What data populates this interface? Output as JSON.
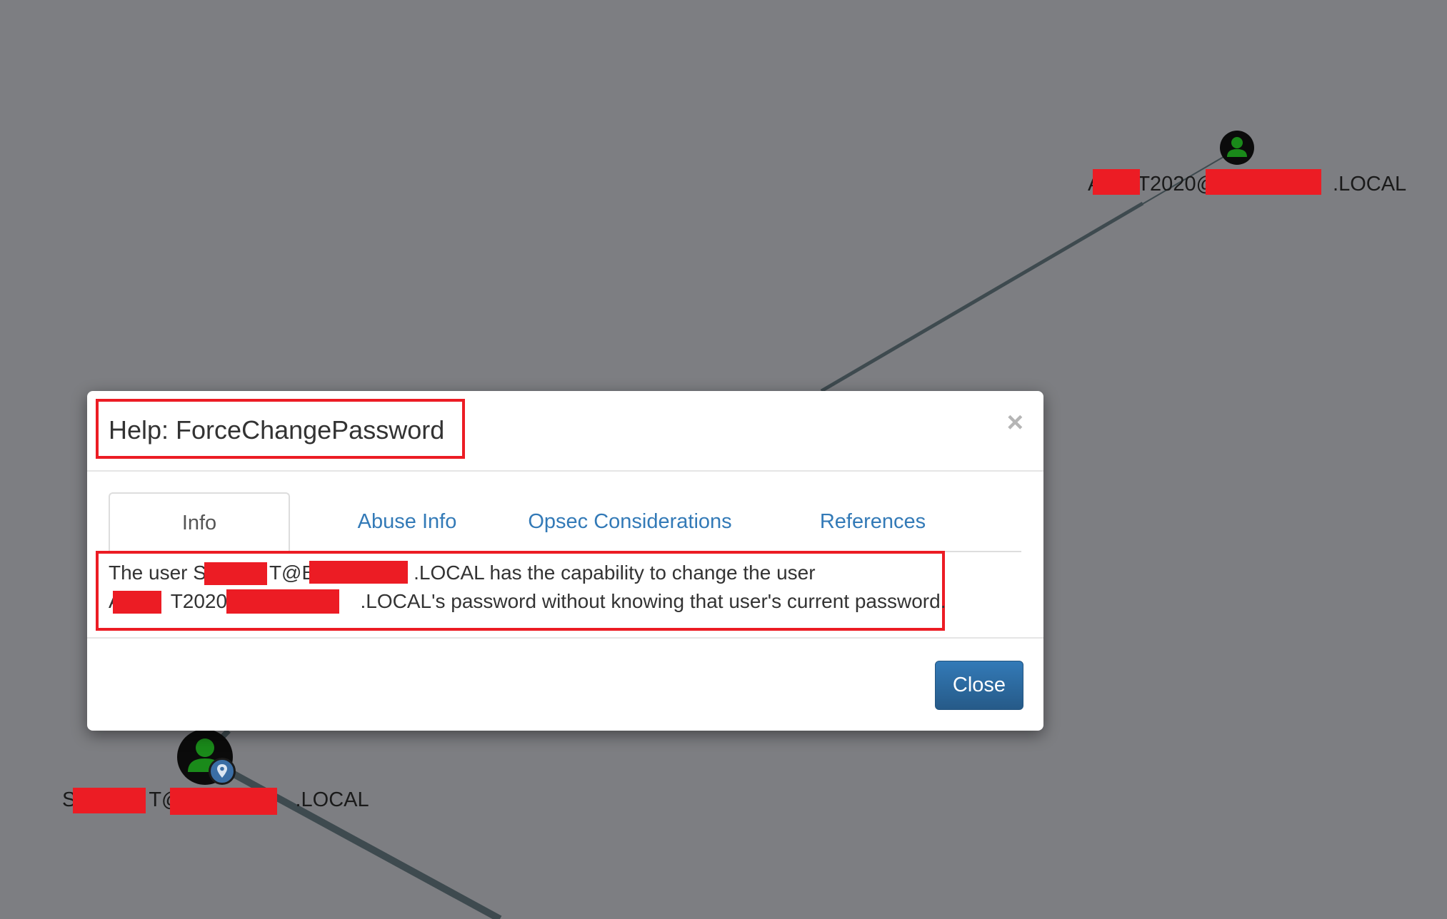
{
  "graph": {
    "top_node": {
      "label_prefix": "A",
      "label_mid": "T2020@",
      "label_suffix": ".LOCAL"
    },
    "bottom_node": {
      "label_prefix": "S",
      "label_mid": "T@",
      "label_suffix": ".LOCAL"
    },
    "colors": {
      "background": "#7d7e82",
      "edge": "#3e4a4f",
      "user_icon": "#1a8a1a",
      "redaction": "#ec1c24"
    }
  },
  "modal": {
    "title": "Help: ForceChangePassword",
    "close_symbol": "×",
    "tabs": [
      {
        "label": "Info",
        "active": true
      },
      {
        "label": "Abuse Info",
        "active": false
      },
      {
        "label": "Opsec Considerations",
        "active": false
      },
      {
        "label": "References",
        "active": false
      }
    ],
    "body": {
      "line1_a": "The user S",
      "line1_b": "T@B",
      "line1_c": ".LOCAL has the capability to change the user",
      "line2_a": "A",
      "line2_b": "T2020@",
      "line2_c": ".LOCAL's password without knowing that user's current password."
    },
    "close_button": "Close"
  }
}
